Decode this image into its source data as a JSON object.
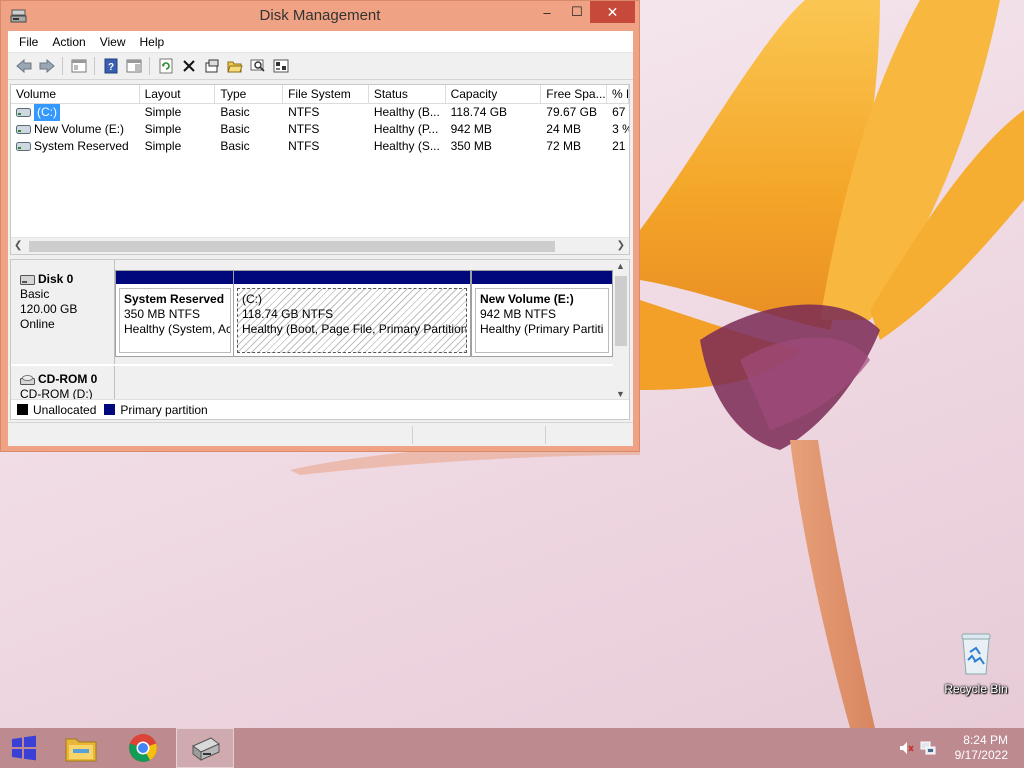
{
  "window": {
    "title": "Disk Management",
    "controls": {
      "minimize": "–",
      "maximize": "☐",
      "close": "✕"
    }
  },
  "menu": [
    "File",
    "Action",
    "View",
    "Help"
  ],
  "toolbar_icons": [
    "back-icon",
    "forward-icon",
    "console-tree-icon",
    "help-icon",
    "properties-pane-icon",
    "refresh-icon",
    "delete-icon",
    "properties-icon",
    "open-icon",
    "search-icon",
    "rescan-icon"
  ],
  "volume_list": {
    "columns": [
      "Volume",
      "Layout",
      "Type",
      "File System",
      "Status",
      "Capacity",
      "Free Spa...",
      "% F"
    ],
    "rows": [
      {
        "volume": "(C:)",
        "layout": "Simple",
        "type": "Basic",
        "fs": "NTFS",
        "status": "Healthy (B...",
        "capacity": "118.74 GB",
        "free": "79.67 GB",
        "pct": "67"
      },
      {
        "volume": "New Volume (E:)",
        "layout": "Simple",
        "type": "Basic",
        "fs": "NTFS",
        "status": "Healthy (P...",
        "capacity": "942 MB",
        "free": "24 MB",
        "pct": "3 %"
      },
      {
        "volume": "System Reserved",
        "layout": "Simple",
        "type": "Basic",
        "fs": "NTFS",
        "status": "Healthy (S...",
        "capacity": "350 MB",
        "free": "72 MB",
        "pct": "21"
      }
    ]
  },
  "disk0": {
    "name": "Disk 0",
    "type": "Basic",
    "size": "120.00 GB",
    "state": "Online",
    "partitions": [
      {
        "name": "System Reserved",
        "size": "350 MB NTFS",
        "status": "Healthy (System, Ac"
      },
      {
        "name": "(C:)",
        "size": "118.74 GB NTFS",
        "status": "Healthy (Boot, Page File, Primary Partition"
      },
      {
        "name": "New Volume  (E:)",
        "size": "942 MB NTFS",
        "status": "Healthy (Primary Partiti"
      }
    ]
  },
  "cdrom": {
    "name": "CD-ROM 0",
    "drive": "CD-ROM (D:)"
  },
  "legend": [
    {
      "label": "Unallocated",
      "color": "#000000"
    },
    {
      "label": "Primary partition",
      "color": "#00087c"
    }
  ],
  "desktop": {
    "recycle_bin": "Recycle Bin"
  },
  "taskbar": {
    "apps": [
      "file-explorer-icon",
      "chrome-icon",
      "disk-management-icon"
    ],
    "time": "8:24 PM",
    "date": "9/17/2022"
  },
  "colors": {
    "window_frame": "#f0a384",
    "close_button": "#c7493a",
    "partition_bar": "#00087c",
    "taskbar": "#bd8a90",
    "selection": "#3399ff"
  }
}
